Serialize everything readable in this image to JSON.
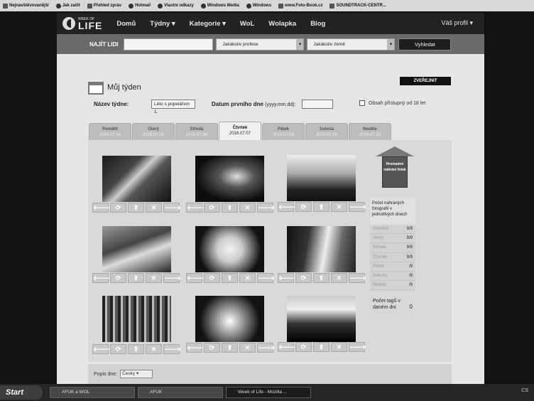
{
  "bookmarks": [
    {
      "label": "Nejnavštěvovanější",
      "icon": "page-icon"
    },
    {
      "label": "Jak začít",
      "icon": "firefox-icon"
    },
    {
      "label": "Přehled zpráv",
      "icon": "rss-icon"
    },
    {
      "label": "Hotmail",
      "icon": "msn-icon"
    },
    {
      "label": "Vlastní odkazy",
      "icon": "msn-icon"
    },
    {
      "label": "Windows Media",
      "icon": "msn-icon"
    },
    {
      "label": "Windows",
      "icon": "msn-icon"
    },
    {
      "label": "www.Foto-Book.cz",
      "icon": "page-icon"
    },
    {
      "label": "SOUNDTRACK-CENTR...",
      "icon": "page-icon"
    }
  ],
  "nav": {
    "logo_top": "WEEK OF",
    "logo_bottom": "LIFE",
    "items": [
      "Domů",
      "Týdny ▾",
      "Kategorie ▾",
      "WoL",
      "Wolapka",
      "Blog"
    ],
    "profile": "Váš profil ▾"
  },
  "search": {
    "label": "NAJÍT LIDI",
    "profession": "Jakákoliv profese",
    "country": "Jakákoliv země",
    "button": "Vyhledat"
  },
  "week": {
    "title": "Můj týden",
    "publish": "ZVEŘEJNIT",
    "name_label": "Název týdne:",
    "name_value": "Léto s popelářem 1.",
    "first_day_label": "Datum prvního dne",
    "first_day_hint": "(yyyy.mm.dd):",
    "adult_label": "Obsah přístupný od 18 let"
  },
  "tabs": [
    {
      "day": "Pondělí",
      "date": "2016.07.04"
    },
    {
      "day": "Úterý",
      "date": "2016.07.05"
    },
    {
      "day": "Středa",
      "date": "2016.07.06"
    },
    {
      "day": "Čtvrtek",
      "date": "2016.07.07"
    },
    {
      "day": "Pátek",
      "date": "2016.07.08"
    },
    {
      "day": "Sobota",
      "date": "2016.07.09"
    },
    {
      "day": "Neděle",
      "date": "2016.07.10"
    }
  ],
  "controls": [
    "🡐",
    "⟳",
    "⬆",
    "✕",
    "🡒"
  ],
  "upload": {
    "label": "Hromadné nahrání fotek"
  },
  "counts": {
    "header": "Počet nahraných fotografií v jednotlivých dnech",
    "rows": [
      {
        "day": "Pondělí",
        "count": "9/9"
      },
      {
        "day": "Úterý",
        "count": "9/9"
      },
      {
        "day": "Středa",
        "count": "9/9"
      },
      {
        "day": "Čtvrtek",
        "count": "9/9"
      },
      {
        "day": "Pátek",
        "count": "/9"
      },
      {
        "day": "Sobota",
        "count": "/9"
      },
      {
        "day": "Neděle",
        "count": "/9"
      }
    ]
  },
  "tags": {
    "label": "Počet tagů v daném dni",
    "value": "0"
  },
  "bottom": {
    "label": "Popis dne:",
    "lang": "Česky ▾"
  },
  "taskbar": {
    "start": "Start",
    "items": [
      "AFUK a WOL",
      "AFUK",
      "Week of Life - Mozilla ..."
    ],
    "tray": "CS"
  }
}
